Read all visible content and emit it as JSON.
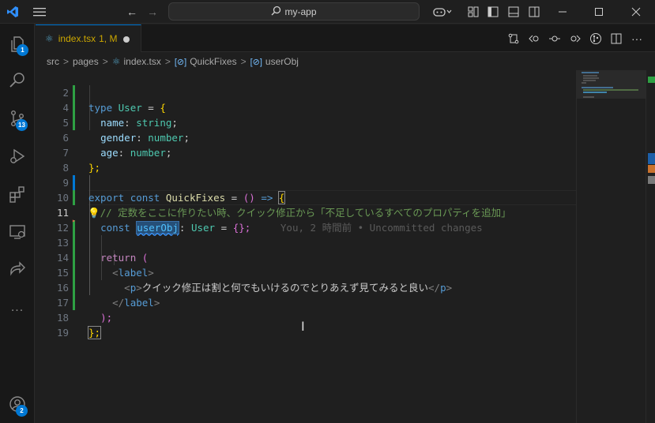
{
  "titlebar": {
    "search_text": "my-app",
    "nav_back": "←",
    "nav_forward": "→"
  },
  "activitybar": {
    "items": [
      {
        "name": "explorer",
        "badge": "1"
      },
      {
        "name": "search",
        "badge": ""
      },
      {
        "name": "source-control",
        "badge": "13"
      },
      {
        "name": "run-debug",
        "badge": ""
      },
      {
        "name": "extensions",
        "badge": ""
      },
      {
        "name": "remote-explorer",
        "badge": ""
      },
      {
        "name": "live-share",
        "badge": ""
      },
      {
        "name": "more",
        "badge": ""
      }
    ],
    "more_label": "...",
    "accounts_badge": "2"
  },
  "tab": {
    "filename": "index.tsx",
    "status": "1, M"
  },
  "breadcrumb": {
    "items": [
      "src",
      "pages",
      "index.tsx",
      "QuickFixes",
      "userObj"
    ]
  },
  "editor": {
    "line_numbers": [
      "2",
      "4",
      "5",
      "6",
      "7",
      "8",
      "9",
      "10",
      "11",
      "12",
      "13",
      "14",
      "15",
      "16",
      "17",
      "18",
      "19"
    ],
    "current_line": "11",
    "lines": {
      "l2": [
        "type",
        "User",
        "=",
        "{"
      ],
      "l4": [
        "name",
        ":",
        "string",
        ";"
      ],
      "l5": [
        "gender",
        ":",
        "number",
        ";"
      ],
      "l6": [
        "age",
        ":",
        "number",
        ";"
      ],
      "l7": [
        "};"
      ],
      "l9": [
        "export",
        "const",
        "QuickFixes",
        "=",
        "()",
        "=>",
        "{"
      ],
      "l10": "// 定数をここに作りたい時、クイック修正から「不足しているすべてのプロパティを追加」",
      "l11": [
        "const",
        "userObj",
        ":",
        "User",
        "=",
        "{};"
      ],
      "l11_blame": "You, 2 時間前 • Uncommitted changes",
      "l13": [
        "return",
        "("
      ],
      "l14": [
        "<",
        "label",
        ">"
      ],
      "l15_text": "クイック修正は割と何でもいけるのでとりあえず見てみると良い",
      "l15_open": [
        "<",
        "p",
        ">"
      ],
      "l15_close": [
        "</",
        "p",
        ">"
      ],
      "l16": [
        "</",
        "label",
        ">"
      ],
      "l17": [
        ");"
      ],
      "l18": [
        "};"
      ]
    }
  },
  "colors": {
    "accent": "#0078d4",
    "background": "#1f1f1f",
    "modified": "#cca700"
  }
}
